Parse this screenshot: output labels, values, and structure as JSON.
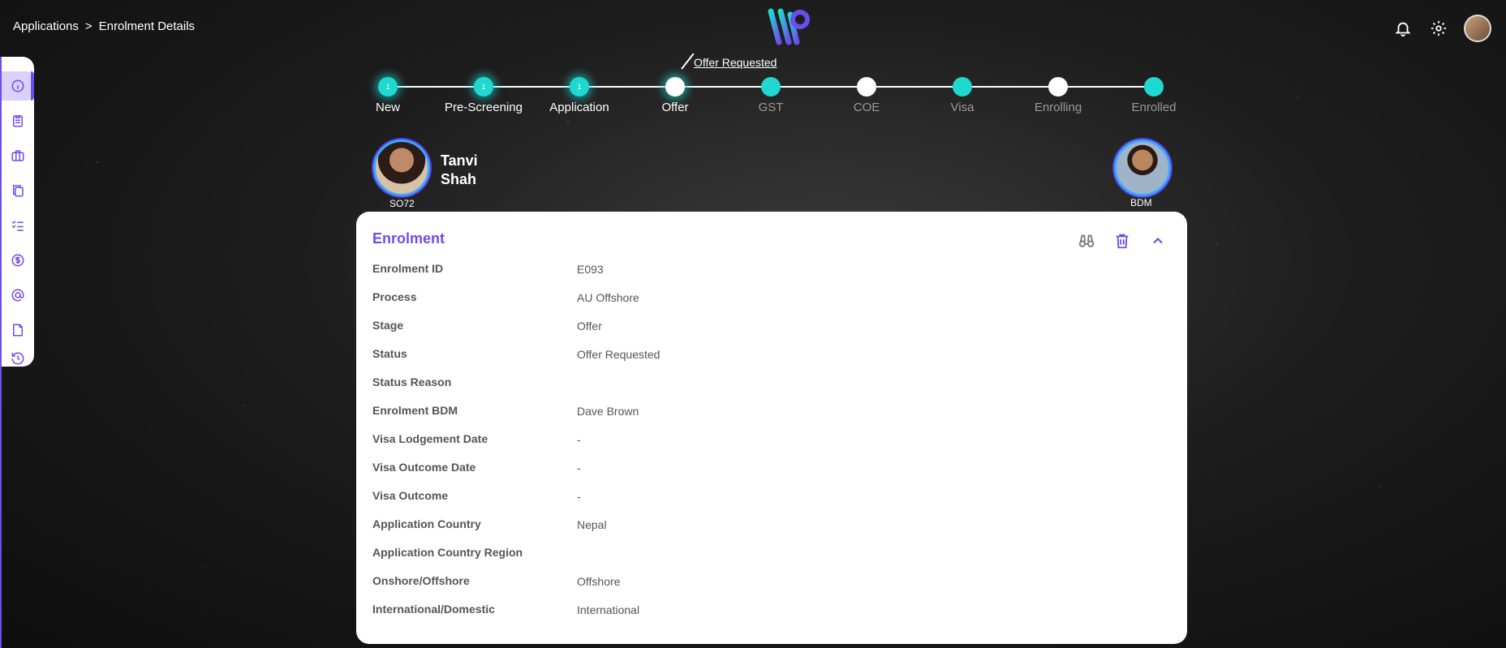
{
  "breadcrumb": {
    "parent": "Applications",
    "separator": ">",
    "current": "Enrolment Details"
  },
  "stepper": {
    "callout": "Offer Requested",
    "steps": [
      {
        "label": "New",
        "badge": "1",
        "state": "done"
      },
      {
        "label": "Pre-Screening",
        "badge": "1",
        "state": "done"
      },
      {
        "label": "Application",
        "badge": "1",
        "state": "done"
      },
      {
        "label": "Offer",
        "badge": "",
        "state": "current"
      },
      {
        "label": "GST",
        "badge": "",
        "state": "todo-teal"
      },
      {
        "label": "COE",
        "badge": "",
        "state": "todo-white"
      },
      {
        "label": "Visa",
        "badge": "",
        "state": "todo-teal"
      },
      {
        "label": "Enrolling",
        "badge": "",
        "state": "todo-white"
      },
      {
        "label": "Enrolled",
        "badge": "",
        "state": "todo-teal"
      }
    ]
  },
  "student": {
    "name": "Tanvi Shah",
    "id": "SO72"
  },
  "bdm": {
    "label": "BDM"
  },
  "card": {
    "title": "Enrolment",
    "rows": [
      {
        "label": "Enrolment ID",
        "value": "E093"
      },
      {
        "label": "Process",
        "value": "AU Offshore"
      },
      {
        "label": "Stage",
        "value": "Offer"
      },
      {
        "label": "Status",
        "value": "Offer Requested"
      },
      {
        "label": "Status Reason",
        "value": ""
      },
      {
        "label": "Enrolment BDM",
        "value": "Dave Brown"
      },
      {
        "label": "Visa Lodgement Date",
        "value": "-"
      },
      {
        "label": "Visa Outcome Date",
        "value": "-"
      },
      {
        "label": "Visa Outcome",
        "value": "-"
      },
      {
        "label": "Application Country",
        "value": "Nepal"
      },
      {
        "label": "Application Country Region",
        "value": ""
      },
      {
        "label": "Onshore/Offshore",
        "value": "Offshore"
      },
      {
        "label": "International/Domestic",
        "value": "International"
      }
    ]
  },
  "sidebar": {
    "items": [
      {
        "icon": "info-icon",
        "active": true
      },
      {
        "icon": "clipboard-icon",
        "active": false
      },
      {
        "icon": "briefcase-icon",
        "active": false
      },
      {
        "icon": "copy-icon",
        "active": false
      },
      {
        "icon": "checklist-icon",
        "active": false
      },
      {
        "icon": "dollar-icon",
        "active": false
      },
      {
        "icon": "at-icon",
        "active": false
      },
      {
        "icon": "file-icon",
        "active": false
      },
      {
        "icon": "history-icon",
        "active": false
      }
    ]
  },
  "colors": {
    "accent": "#6d4cf0",
    "teal": "#1fd8d0"
  }
}
